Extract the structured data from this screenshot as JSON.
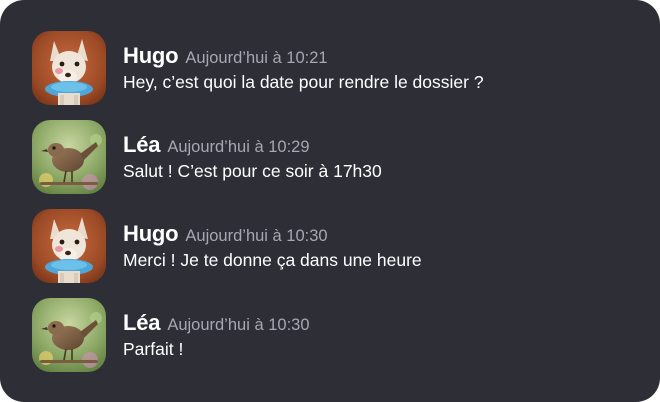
{
  "messages": [
    {
      "author": "Hugo",
      "time": "Aujourd’hui à 10:21",
      "text": "Hey, c’est quoi la date pour rendre le dossier ?",
      "avatar": "dog-avatar"
    },
    {
      "author": "Léa",
      "time": "Aujourd’hui à 10:29",
      "text": "Salut ! C’est pour ce soir à 17h30",
      "avatar": "bird-avatar"
    },
    {
      "author": "Hugo",
      "time": "Aujourd’hui à 10:30",
      "text": "Merci ! Je te donne ça dans une heure",
      "avatar": "dog-avatar"
    },
    {
      "author": "Léa",
      "time": "Aujourd’hui à 10:30",
      "text": "Parfait !",
      "avatar": "bird-avatar"
    }
  ],
  "colors": {
    "background": "#2d2e36",
    "author_text": "#ffffff",
    "timestamp_text": "#a6a7b0",
    "message_text": "#ffffff"
  }
}
